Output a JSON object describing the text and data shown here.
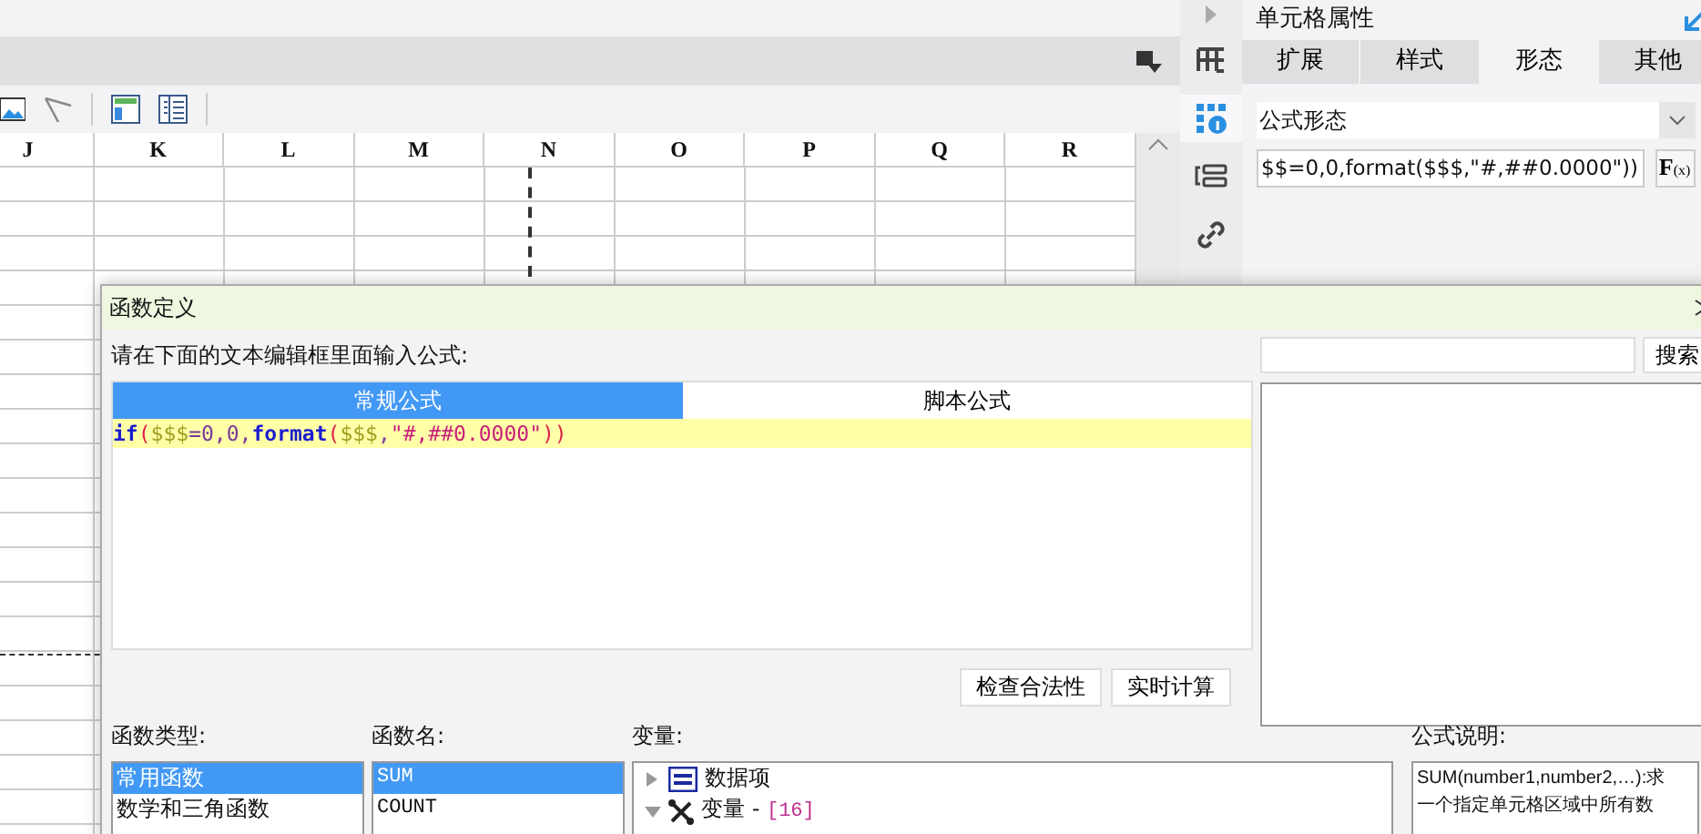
{
  "sheet": {
    "columns": [
      "J",
      "K",
      "L",
      "M",
      "N",
      "O",
      "P",
      "Q",
      "R"
    ]
  },
  "side_icons": [
    {
      "kind": "frame",
      "selected": false
    },
    {
      "kind": "grid-info",
      "selected": true
    },
    {
      "kind": "stack",
      "selected": false
    },
    {
      "kind": "link",
      "selected": false
    }
  ],
  "panel": {
    "title": "单元格属性",
    "tabs": [
      {
        "label": "扩展",
        "selected": false
      },
      {
        "label": "样式",
        "selected": false
      },
      {
        "label": "形态",
        "selected": true
      },
      {
        "label": "其他",
        "selected": false
      }
    ],
    "form_select": {
      "value": "公式形态"
    },
    "formula_field": {
      "value": "$$=0,0,format($$$,\"#,##0.0000\"))"
    },
    "fx_button": {
      "text": "F",
      "sub": "(x)"
    }
  },
  "dialog": {
    "title": "函数定义",
    "prompt": "请在下面的文本编辑框里面输入公式:",
    "tabs": [
      {
        "label": "常规公式",
        "selected": true
      },
      {
        "label": "脚本公式",
        "selected": false
      }
    ],
    "formula_tokens": [
      {
        "kind": "keyword",
        "text": "if"
      },
      {
        "kind": "paren",
        "text": "("
      },
      {
        "kind": "var",
        "text": "$$$"
      },
      {
        "kind": "plain",
        "text": "=0,0,"
      },
      {
        "kind": "keyword",
        "text": "format"
      },
      {
        "kind": "paren",
        "text": "("
      },
      {
        "kind": "var",
        "text": "$$$"
      },
      {
        "kind": "plain",
        "text": ","
      },
      {
        "kind": "string",
        "text": "\"#,##0.0000\""
      },
      {
        "kind": "paren",
        "text": "))"
      }
    ],
    "search_button": "搜索",
    "buttons": [
      "检查合法性",
      "实时计算"
    ],
    "function_types": {
      "label": "函数类型:",
      "items": [
        {
          "text": "常用函数",
          "selected": true
        },
        {
          "text": "数学和三角函数",
          "selected": false
        }
      ]
    },
    "function_names": {
      "label": "函数名:",
      "items": [
        {
          "text": "SUM",
          "selected": true
        },
        {
          "text": "COUNT",
          "selected": false
        }
      ]
    },
    "variables": {
      "label": "变量:",
      "items": [
        {
          "kind": "data",
          "text": "数据项",
          "expanded": false
        },
        {
          "kind": "vars",
          "text": "变量 - ",
          "count": "[16]",
          "expanded": true
        }
      ]
    },
    "description": {
      "label": "公式说明:",
      "lines": [
        "SUM(number1,number2,…):求",
        "一个指定单元格区域中所有数"
      ]
    }
  }
}
